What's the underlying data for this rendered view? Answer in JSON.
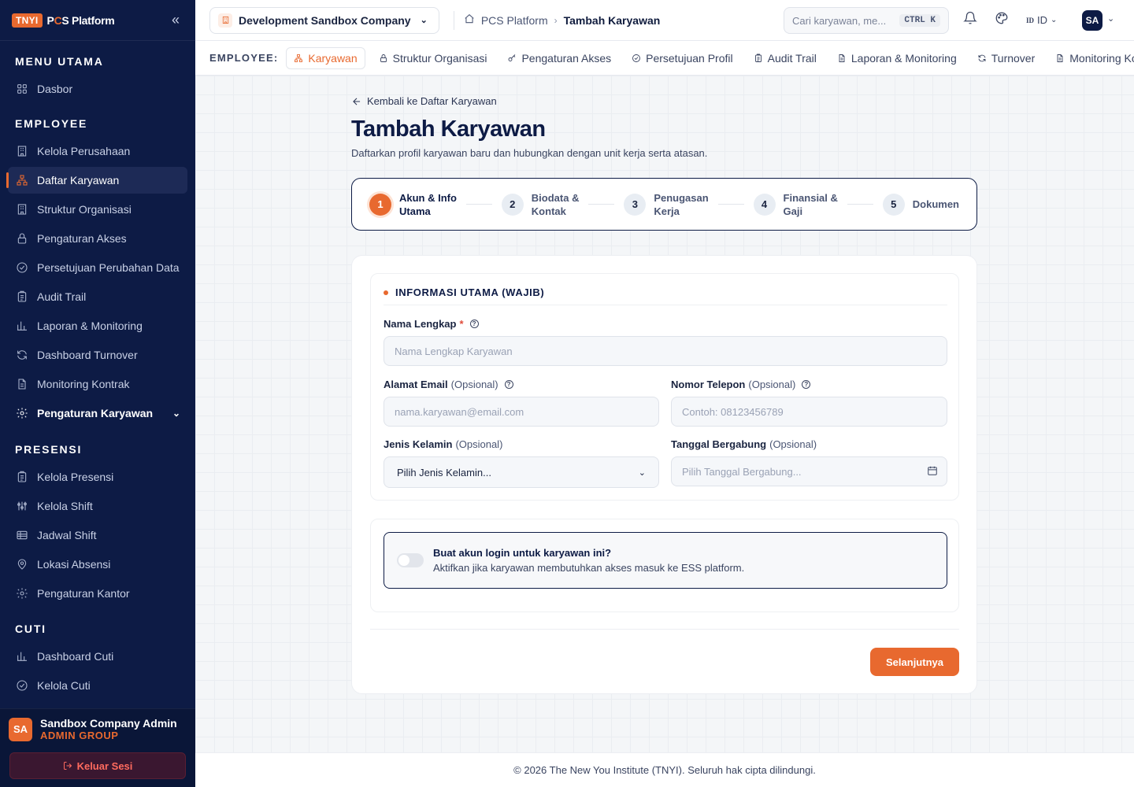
{
  "brand": {
    "badge": "TNYI",
    "name_prefix": "P",
    "name_accent": "C",
    "name_rest": "S Platform"
  },
  "sidebar": {
    "groups": [
      {
        "heading": "MENU UTAMA",
        "items": [
          {
            "label": "Dasbor",
            "icon": "grid-icon"
          }
        ]
      },
      {
        "heading": "EMPLOYEE",
        "items": [
          {
            "label": "Kelola Perusahaan",
            "icon": "building-icon"
          },
          {
            "label": "Daftar Karyawan",
            "icon": "org-icon",
            "active": true
          },
          {
            "label": "Struktur Organisasi",
            "icon": "building-icon"
          },
          {
            "label": "Pengaturan Akses",
            "icon": "lock-icon"
          },
          {
            "label": "Persetujuan Perubahan Data",
            "icon": "check-circle-icon"
          },
          {
            "label": "Audit Trail",
            "icon": "clipboard-icon"
          },
          {
            "label": "Laporan & Monitoring",
            "icon": "bar-chart-icon"
          },
          {
            "label": "Dashboard Turnover",
            "icon": "refresh-icon"
          },
          {
            "label": "Monitoring Kontrak",
            "icon": "file-icon"
          },
          {
            "label": "Pengaturan Karyawan",
            "icon": "gear-icon",
            "bold": true,
            "expandable": true
          }
        ]
      },
      {
        "heading": "PRESENSI",
        "items": [
          {
            "label": "Kelola Presensi",
            "icon": "clipboard-icon"
          },
          {
            "label": "Kelola Shift",
            "icon": "sliders-icon"
          },
          {
            "label": "Jadwal Shift",
            "icon": "table-icon"
          },
          {
            "label": "Lokasi Absensi",
            "icon": "pin-icon"
          },
          {
            "label": "Pengaturan Kantor",
            "icon": "gear-icon"
          }
        ]
      },
      {
        "heading": "CUTI",
        "items": [
          {
            "label": "Dashboard Cuti",
            "icon": "bar-chart-icon"
          },
          {
            "label": "Kelola Cuti",
            "icon": "check-circle-icon"
          }
        ]
      }
    ],
    "user": {
      "initials": "SA",
      "name": "Sandbox Company Admin",
      "role": "ADMIN GROUP"
    },
    "logout_label": "Keluar Sesi"
  },
  "header": {
    "company": "Development Sandbox Company",
    "breadcrumb": [
      "PCS Platform",
      "Tambah Karyawan"
    ],
    "search_placeholder": "Cari karyawan, me...",
    "search_shortcut": "CTRL K",
    "lang_flag": "ID",
    "lang": "ID",
    "avatar": "SA"
  },
  "subnav": {
    "label": "EMPLOYEE:",
    "items": [
      {
        "label": "Karyawan",
        "icon": "org-icon",
        "active": true
      },
      {
        "label": "Struktur Organisasi",
        "icon": "lock-icon"
      },
      {
        "label": "Pengaturan Akses",
        "icon": "key-icon"
      },
      {
        "label": "Persetujuan Profil",
        "icon": "check-circle-icon"
      },
      {
        "label": "Audit Trail",
        "icon": "clipboard-icon"
      },
      {
        "label": "Laporan & Monitoring",
        "icon": "file-icon"
      },
      {
        "label": "Turnover",
        "icon": "refresh-icon"
      },
      {
        "label": "Monitoring Kontrak",
        "icon": "file-icon"
      }
    ]
  },
  "page": {
    "back_label": "Kembali ke Daftar Karyawan",
    "title": "Tambah Karyawan",
    "subtitle": "Daftarkan profil karyawan baru dan hubungkan dengan unit kerja serta atasan."
  },
  "steps": [
    {
      "num": "1",
      "line1": "Akun & Info",
      "line2": "Utama",
      "active": true
    },
    {
      "num": "2",
      "line1": "Biodata &",
      "line2": "Kontak"
    },
    {
      "num": "3",
      "line1": "Penugasan",
      "line2": "Kerja"
    },
    {
      "num": "4",
      "line1": "Finansial &",
      "line2": "Gaji"
    },
    {
      "num": "5",
      "line1": "Dokumen",
      "line2": ""
    }
  ],
  "form": {
    "section_title": "INFORMASI UTAMA (WAJIB)",
    "full_name": {
      "label": "Nama Lengkap",
      "required": "*",
      "placeholder": "Nama Lengkap Karyawan",
      "value": ""
    },
    "email": {
      "label": "Alamat Email",
      "optional": "(Opsional)",
      "placeholder": "nama.karyawan@email.com",
      "value": ""
    },
    "phone": {
      "label": "Nomor Telepon",
      "optional": "(Opsional)",
      "placeholder": "Contoh: 08123456789",
      "value": ""
    },
    "gender": {
      "label": "Jenis Kelamin",
      "optional": "(Opsional)",
      "selected": "Pilih Jenis Kelamin..."
    },
    "join_date": {
      "label": "Tanggal Bergabung",
      "optional": "(Opsional)",
      "placeholder": "Pilih Tanggal Bergabung..."
    },
    "login_toggle": {
      "title": "Buat akun login untuk karyawan ini?",
      "desc": "Aktifkan jika karyawan membutuhkan akses masuk ke ESS platform.",
      "enabled": false
    },
    "next_label": "Selanjutnya"
  },
  "footer": "© 2026 The New You Institute (TNYI). Seluruh hak cipta dilindungi.",
  "colors": {
    "accent": "#e8692f",
    "sidebar": "#0d1b45",
    "danger": "#ff6b5e"
  }
}
